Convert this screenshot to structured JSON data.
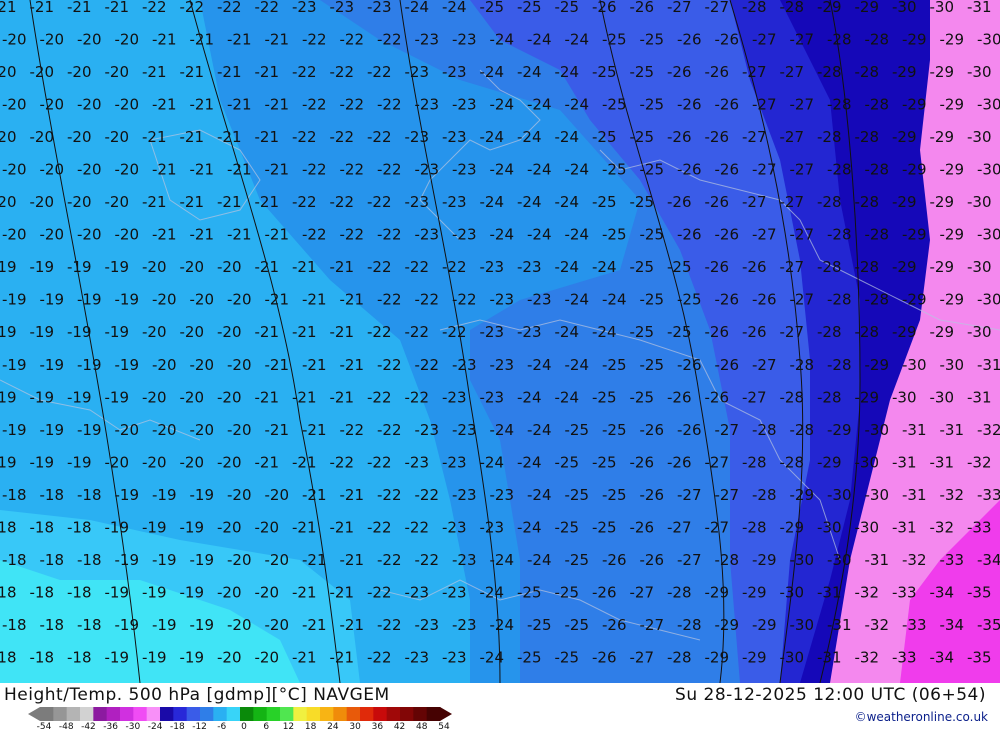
{
  "map": {
    "field": "500 hPa temperature",
    "colors": {
      "c18": "#38c8f8",
      "c19": "#2ab0f2",
      "c20": "#2694ec",
      "c22": "#2f7ee8",
      "c24": "#3a5ce8",
      "c26": "#2326d2",
      "c27": "#1508b8",
      "c30": "#f488ee",
      "c33": "#f03cec",
      "cyan": "#40e4f6"
    },
    "labels": [
      {
        "row": 0,
        "start": -21,
        "end": -31
      },
      {
        "row": 1,
        "start": -20,
        "end": -30
      },
      {
        "row": 2,
        "start": -20,
        "end": -30
      },
      {
        "row": 3,
        "start": -20,
        "end": -30
      },
      {
        "row": 4,
        "start": -20,
        "end": -30
      },
      {
        "row": 5,
        "start": -20,
        "end": -30
      },
      {
        "row": 6,
        "start": -20,
        "end": -30
      },
      {
        "row": 7,
        "start": -20,
        "end": -30
      },
      {
        "row": 8,
        "start": -19,
        "end": -30
      },
      {
        "row": 9,
        "start": -19,
        "end": -30
      },
      {
        "row": 10,
        "start": -19,
        "end": -30
      },
      {
        "row": 11,
        "start": -19,
        "end": -31
      },
      {
        "row": 12,
        "start": -19,
        "end": -31
      },
      {
        "row": 13,
        "start": -19,
        "end": -32
      },
      {
        "row": 14,
        "start": -19,
        "end": -32
      },
      {
        "row": 15,
        "start": -18,
        "end": -33
      },
      {
        "row": 16,
        "start": -18,
        "end": -33
      },
      {
        "row": 17,
        "start": -18,
        "end": -34
      },
      {
        "row": 18,
        "start": -18,
        "end": -35
      },
      {
        "row": 19,
        "start": -18,
        "end": -35
      },
      {
        "row": 20,
        "start": -18,
        "end": -35
      }
    ]
  },
  "footer": {
    "title": "Height/Temp. 500 hPa [gdmp][°C] NAVGEM",
    "valid": "Su 28-12-2025 12:00 UTC (06+54)",
    "credit": "©weatheronline.co.uk",
    "scale_ticks": [
      "-54",
      "-48",
      "-42",
      "-36",
      "-30",
      "-24",
      "-18",
      "-12",
      "-6",
      "0",
      "6",
      "12",
      "18",
      "24",
      "30",
      "36",
      "42",
      "48",
      "54"
    ],
    "scale_colors": [
      "#7c7c7c",
      "#969696",
      "#b4b4b4",
      "#d2d2d2",
      "#8c1aa0",
      "#b020c0",
      "#d030e0",
      "#f04cf4",
      "#f890f8",
      "#1a0aa8",
      "#2828d8",
      "#3a5ce8",
      "#2f7ee8",
      "#2ab0f2",
      "#38d4f8",
      "#0a8a0a",
      "#14b414",
      "#28d228",
      "#50e650",
      "#f0f040",
      "#f8dc28",
      "#f8b414",
      "#f08c0a",
      "#e85a0a",
      "#e02a0a",
      "#c80a0a",
      "#a00808",
      "#820606",
      "#640404",
      "#460202"
    ]
  }
}
